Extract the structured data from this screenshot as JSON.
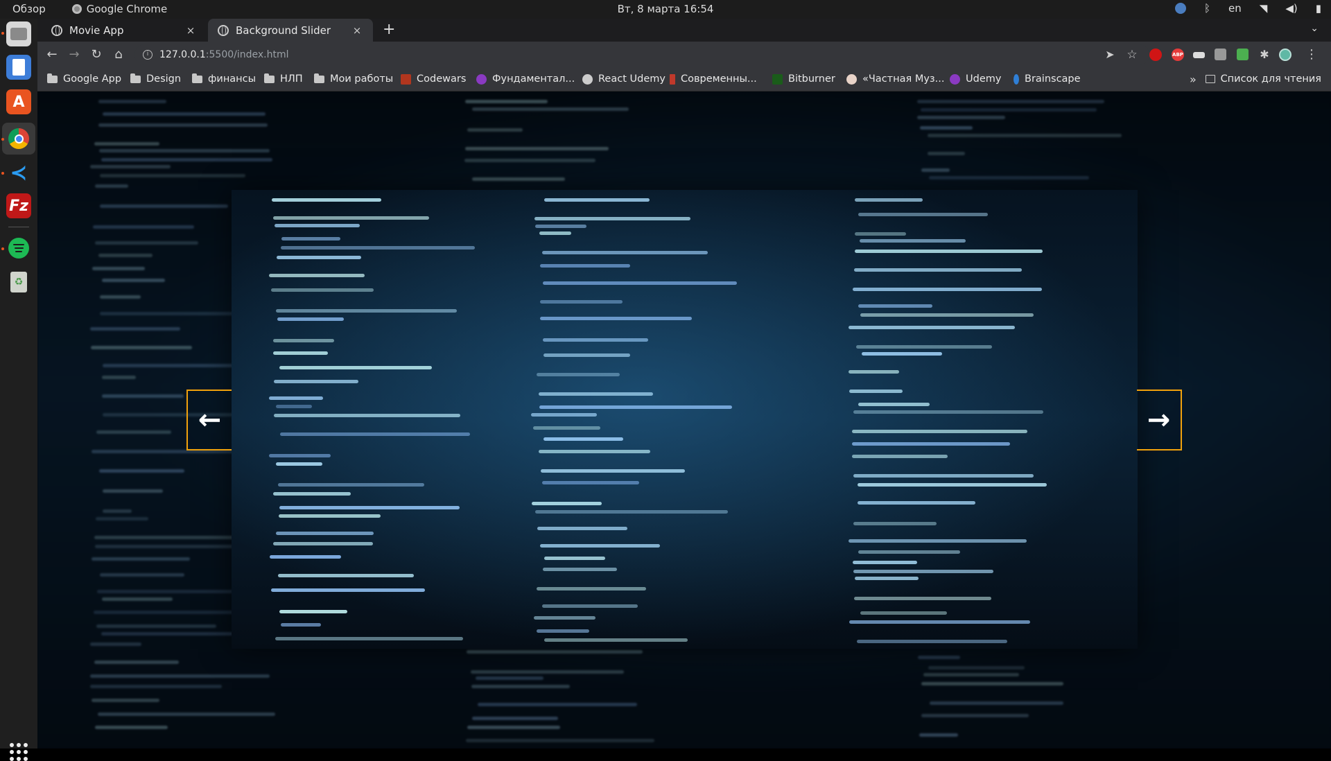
{
  "topbar": {
    "activities": "Обзор",
    "app_name": "Google Chrome",
    "clock": "Вт, 8 марта  16:54",
    "lang": "en"
  },
  "dock": {
    "items": [
      "files-icon",
      "text-editor-icon",
      "software-center-icon",
      "chrome-icon",
      "vscode-icon",
      "filezilla-icon",
      "spotify-icon",
      "trash-icon"
    ]
  },
  "tabs": [
    {
      "title": "Movie App",
      "close": "×"
    },
    {
      "title": "Background Slider",
      "close": "×"
    }
  ],
  "newtab_label": "+",
  "address": {
    "host": "127.0.0.1",
    "path": ":5500/index.html"
  },
  "bookmarks": [
    {
      "label": "Google App",
      "type": "folder"
    },
    {
      "label": "Design",
      "type": "folder"
    },
    {
      "label": "финансы",
      "type": "folder"
    },
    {
      "label": "НЛП",
      "type": "folder"
    },
    {
      "label": "Мои работы",
      "type": "folder"
    },
    {
      "label": "Codewars",
      "type": "site",
      "color": "#b1361e"
    },
    {
      "label": "Фундаментал...",
      "type": "site",
      "color": "#8a3ac2"
    },
    {
      "label": "React Udemy",
      "type": "site",
      "color": "#cccccc"
    },
    {
      "label": "Современны...",
      "type": "site",
      "color": "#c0392b"
    },
    {
      "label": "Bitburner",
      "type": "site",
      "color": "#1a5c1a"
    },
    {
      "label": "«Частная Муз...",
      "type": "site",
      "color": "#e8d3c8"
    },
    {
      "label": "Udemy",
      "type": "site",
      "color": "#8a3ac2"
    },
    {
      "label": "Brainscape",
      "type": "site",
      "color": "#2f7fd6"
    }
  ],
  "bookmarks_more": "»",
  "reading_list": "Список для чтения",
  "slider": {
    "accent_color": "#f2a20c",
    "left_arrow": "←",
    "right_arrow": "→"
  }
}
